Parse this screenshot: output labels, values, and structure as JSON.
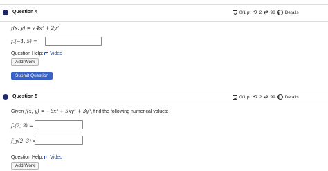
{
  "question4": {
    "title": "Question 4",
    "score": "0/1 pt",
    "retries": "2",
    "submissions": "98",
    "details": "Details",
    "func_lhs": "f(x, y) =",
    "func_root": "√",
    "func_rad": "4x² + 2y²",
    "partial_label": "fₓ(−4, 5) =",
    "answer_value": "",
    "help_label": "Question Help:",
    "video_label": "Video",
    "add_work": "Add Work",
    "submit": "Submit Question"
  },
  "question5": {
    "title": "Question 5",
    "score": "0/1 pt",
    "retries": "2",
    "submissions": "99",
    "details": "Details",
    "given_prefix": "Given",
    "given_func": "f(x, y) = −6x³ + 5xy² + 3y³",
    "given_suffix": ", find the following numerical values:",
    "fx_label": "fₓ(2, 3) =",
    "fx_value": "",
    "fy_label": "f_y(2, 3) =",
    "fy_value": "",
    "help_label": "Question Help:",
    "video_label": "Video",
    "add_work": "Add Work"
  },
  "icons": {
    "edit": "edit-icon",
    "retry": "retry-icon",
    "submissions": "swap-icon",
    "info": "info-icon",
    "video": "video-icon"
  },
  "colors": {
    "dot": "#1f2a6e",
    "primary_button": "#3a62c4",
    "link": "#2a4fb0"
  }
}
